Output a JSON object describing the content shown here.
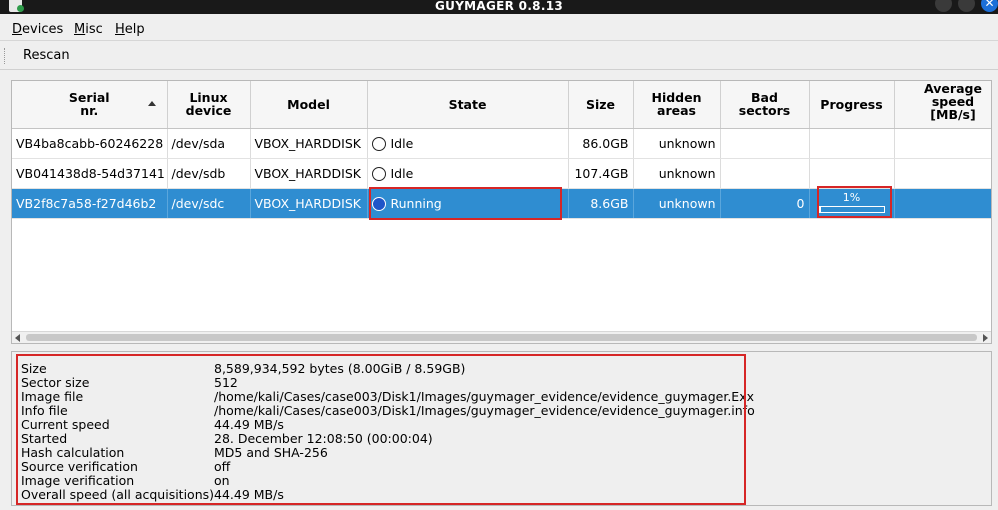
{
  "window": {
    "title": "GUYMAGER 0.8.13"
  },
  "menu": [
    {
      "label": "Devices",
      "mnemonic": "D",
      "rest": "evices"
    },
    {
      "label": "Misc",
      "mnemonic": "M",
      "rest": "isc"
    },
    {
      "label": "Help",
      "mnemonic": "H",
      "rest": "elp"
    }
  ],
  "toolbar": {
    "rescan": "Rescan"
  },
  "table": {
    "headers": {
      "serial": "Serial\nnr.",
      "linux": "Linux\ndevice",
      "model": "Model",
      "state": "State",
      "size": "Size",
      "hidden": "Hidden\nareas",
      "bad": "Bad\nsectors",
      "progress": "Progress",
      "speed": "Average\nspeed\n[MB/s]"
    },
    "rows": [
      {
        "serial": "VB4ba8cabb-60246228",
        "linux": "/dev/sda",
        "model": "VBOX_HARDDISK",
        "state": "Idle",
        "size": "86.0GB",
        "hidden": "unknown",
        "bad": "",
        "progress": ""
      },
      {
        "serial": "VB041438d8-54d37141",
        "linux": "/dev/sdb",
        "model": "VBOX_HARDDISK",
        "state": "Idle",
        "size": "107.4GB",
        "hidden": "unknown",
        "bad": "",
        "progress": ""
      },
      {
        "serial": "VB2f8c7a58-f27d46b2",
        "linux": "/dev/sdc",
        "model": "VBOX_HARDDISK",
        "state": "Running",
        "size": "8.6GB",
        "hidden": "unknown",
        "bad": "0",
        "progress": "1%",
        "progress_fraction": 0.01
      }
    ]
  },
  "info": [
    {
      "key": "Size",
      "value": "8,589,934,592 bytes (8.00GiB / 8.59GB)"
    },
    {
      "key": "Sector size",
      "value": "512"
    },
    {
      "key": "Image file",
      "value": "/home/kali/Cases/case003/Disk1/Images/guymager_evidence/evidence_guymager.Exx"
    },
    {
      "key": "Info file",
      "value": "/home/kali/Cases/case003/Disk1/Images/guymager_evidence/evidence_guymager.info"
    },
    {
      "key": "Current speed",
      "value": "44.49 MB/s"
    },
    {
      "key": "Started",
      "value": "28. December 12:08:50 (00:00:04)"
    },
    {
      "key": "Hash calculation",
      "value": "MD5 and SHA-256"
    },
    {
      "key": "Source verification",
      "value": "off"
    },
    {
      "key": "Image verification",
      "value": "on"
    },
    {
      "key": "Overall speed (all acquisitions)",
      "value": "44.49 MB/s"
    }
  ],
  "colors": {
    "selection": "#2f8dd1",
    "highlight": "#d62626",
    "running_indicator": "#1f55c8"
  }
}
